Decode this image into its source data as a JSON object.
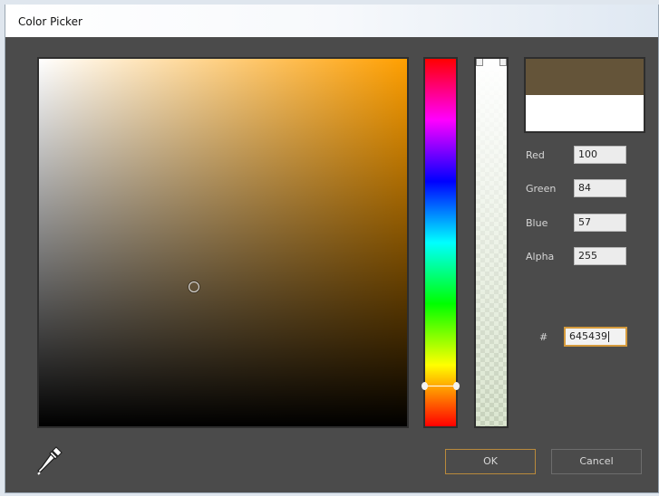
{
  "window": {
    "title": "Color Picker"
  },
  "picker": {
    "hue_color": "#ff9f00",
    "saturation_fraction": 0.42,
    "value_fraction": 0.38,
    "hue_fraction": 0.89,
    "alpha_fraction": 0.0
  },
  "preview": {
    "new_color": "#645439",
    "previous_color": "#ffffff"
  },
  "fields": {
    "red": {
      "label": "Red",
      "value": "100"
    },
    "green": {
      "label": "Green",
      "value": "84"
    },
    "blue": {
      "label": "Blue",
      "value": "57"
    },
    "alpha": {
      "label": "Alpha",
      "value": "255"
    },
    "hex": {
      "label": "#",
      "value": "645439"
    }
  },
  "buttons": {
    "ok": "OK",
    "cancel": "Cancel"
  },
  "icons": {
    "eyedropper": "eyedropper-icon"
  },
  "colors": {
    "accent": "#d49a3d",
    "panel_bg": "#4b4b4b"
  }
}
